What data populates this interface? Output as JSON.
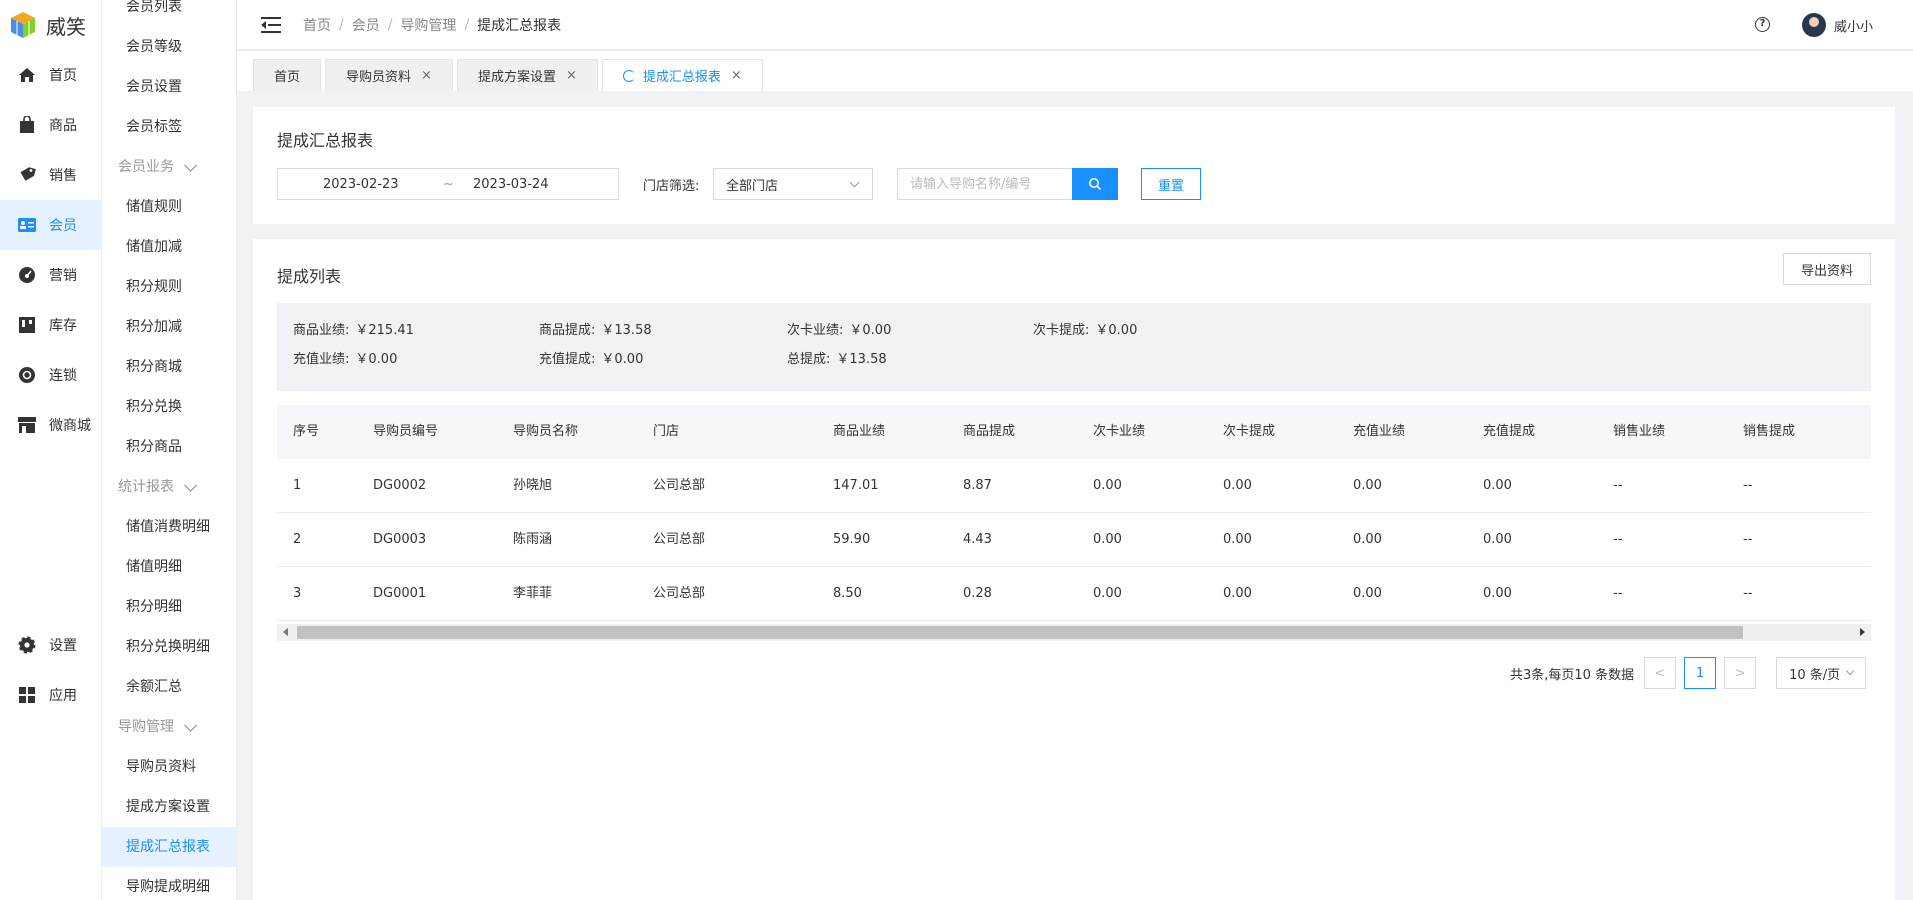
{
  "app": {
    "logo_text": "威笑"
  },
  "main_nav": [
    {
      "label": "首页",
      "icon": "home-icon"
    },
    {
      "label": "商品",
      "icon": "bag-icon"
    },
    {
      "label": "销售",
      "icon": "tag-icon"
    },
    {
      "label": "会员",
      "icon": "member-card-icon",
      "active": true
    },
    {
      "label": "营销",
      "icon": "gauge-icon"
    },
    {
      "label": "库存",
      "icon": "warehouse-icon"
    },
    {
      "label": "连锁",
      "icon": "chain-icon"
    },
    {
      "label": "微商城",
      "icon": "shop-icon"
    }
  ],
  "main_nav_bottom": [
    {
      "label": "设置",
      "icon": "gear-icon"
    },
    {
      "label": "应用",
      "icon": "grid-icon"
    }
  ],
  "sub_nav": [
    {
      "type": "item",
      "label": "会员列表"
    },
    {
      "type": "item",
      "label": "会员等级"
    },
    {
      "type": "item",
      "label": "会员设置"
    },
    {
      "type": "item",
      "label": "会员标签"
    },
    {
      "type": "group",
      "label": "会员业务"
    },
    {
      "type": "item",
      "label": "储值规则"
    },
    {
      "type": "item",
      "label": "储值加减"
    },
    {
      "type": "item",
      "label": "积分规则"
    },
    {
      "type": "item",
      "label": "积分加减"
    },
    {
      "type": "item",
      "label": "积分商城"
    },
    {
      "type": "item",
      "label": "积分兑换"
    },
    {
      "type": "item",
      "label": "积分商品"
    },
    {
      "type": "group",
      "label": "统计报表"
    },
    {
      "type": "item",
      "label": "储值消费明细"
    },
    {
      "type": "item",
      "label": "储值明细"
    },
    {
      "type": "item",
      "label": "积分明细"
    },
    {
      "type": "item",
      "label": "积分兑换明细"
    },
    {
      "type": "item",
      "label": "余额汇总"
    },
    {
      "type": "group",
      "label": "导购管理"
    },
    {
      "type": "item",
      "label": "导购员资料"
    },
    {
      "type": "item",
      "label": "提成方案设置"
    },
    {
      "type": "item",
      "label": "提成汇总报表",
      "active": true
    },
    {
      "type": "item",
      "label": "导购提成明细"
    }
  ],
  "header": {
    "breadcrumb": [
      "首页",
      "会员",
      "导购管理",
      "提成汇总报表"
    ],
    "help_glyph": "?",
    "user_name": "威小小"
  },
  "tabs": [
    {
      "label": "首页",
      "closable": false
    },
    {
      "label": "导购员资料",
      "closable": true
    },
    {
      "label": "提成方案设置",
      "closable": true
    },
    {
      "label": "提成汇总报表",
      "closable": true,
      "active": true
    }
  ],
  "filter": {
    "title": "提成汇总报表",
    "date_start": "2023-02-23",
    "date_sep": "~",
    "date_end": "2023-03-24",
    "store_label": "门店筛选:",
    "store_value": "全部门店",
    "search_placeholder": "请输入导购名称/编号",
    "reset_label": "重置"
  },
  "list": {
    "title": "提成列表",
    "export_label": "导出资料",
    "summary": [
      {
        "label": "商品业绩:",
        "value": "￥215.41"
      },
      {
        "label": "商品提成:",
        "value": "￥13.58"
      },
      {
        "label": "次卡业绩:",
        "value": "￥0.00"
      },
      {
        "label": "次卡提成:",
        "value": "￥0.00"
      },
      {
        "label": "充值业绩:",
        "value": "￥0.00"
      },
      {
        "label": "充值提成:",
        "value": "￥0.00"
      },
      {
        "label": "总提成:",
        "value": "￥13.58"
      }
    ],
    "columns": [
      "序号",
      "导购员编号",
      "导购员名称",
      "门店",
      "商品业绩",
      "商品提成",
      "次卡业绩",
      "次卡提成",
      "充值业绩",
      "充值提成",
      "销售业绩",
      "销售提成"
    ],
    "rows": [
      [
        "1",
        "DG0002",
        "孙晓旭",
        "公司总部",
        "147.01",
        "8.87",
        "0.00",
        "0.00",
        "0.00",
        "0.00",
        "--",
        "--"
      ],
      [
        "2",
        "DG0003",
        "陈雨涵",
        "公司总部",
        "59.90",
        "4.43",
        "0.00",
        "0.00",
        "0.00",
        "0.00",
        "--",
        "--"
      ],
      [
        "3",
        "DG0001",
        "李菲菲",
        "公司总部",
        "8.50",
        "0.28",
        "0.00",
        "0.00",
        "0.00",
        "0.00",
        "--",
        "--"
      ]
    ]
  },
  "pagination": {
    "summary": "共3条,每页10 条数据",
    "prev": "<",
    "current": "1",
    "next": ">",
    "page_size": "10 条/页"
  },
  "colors": {
    "accent": "#1890ff",
    "active_bg": "#e6f2ff"
  }
}
